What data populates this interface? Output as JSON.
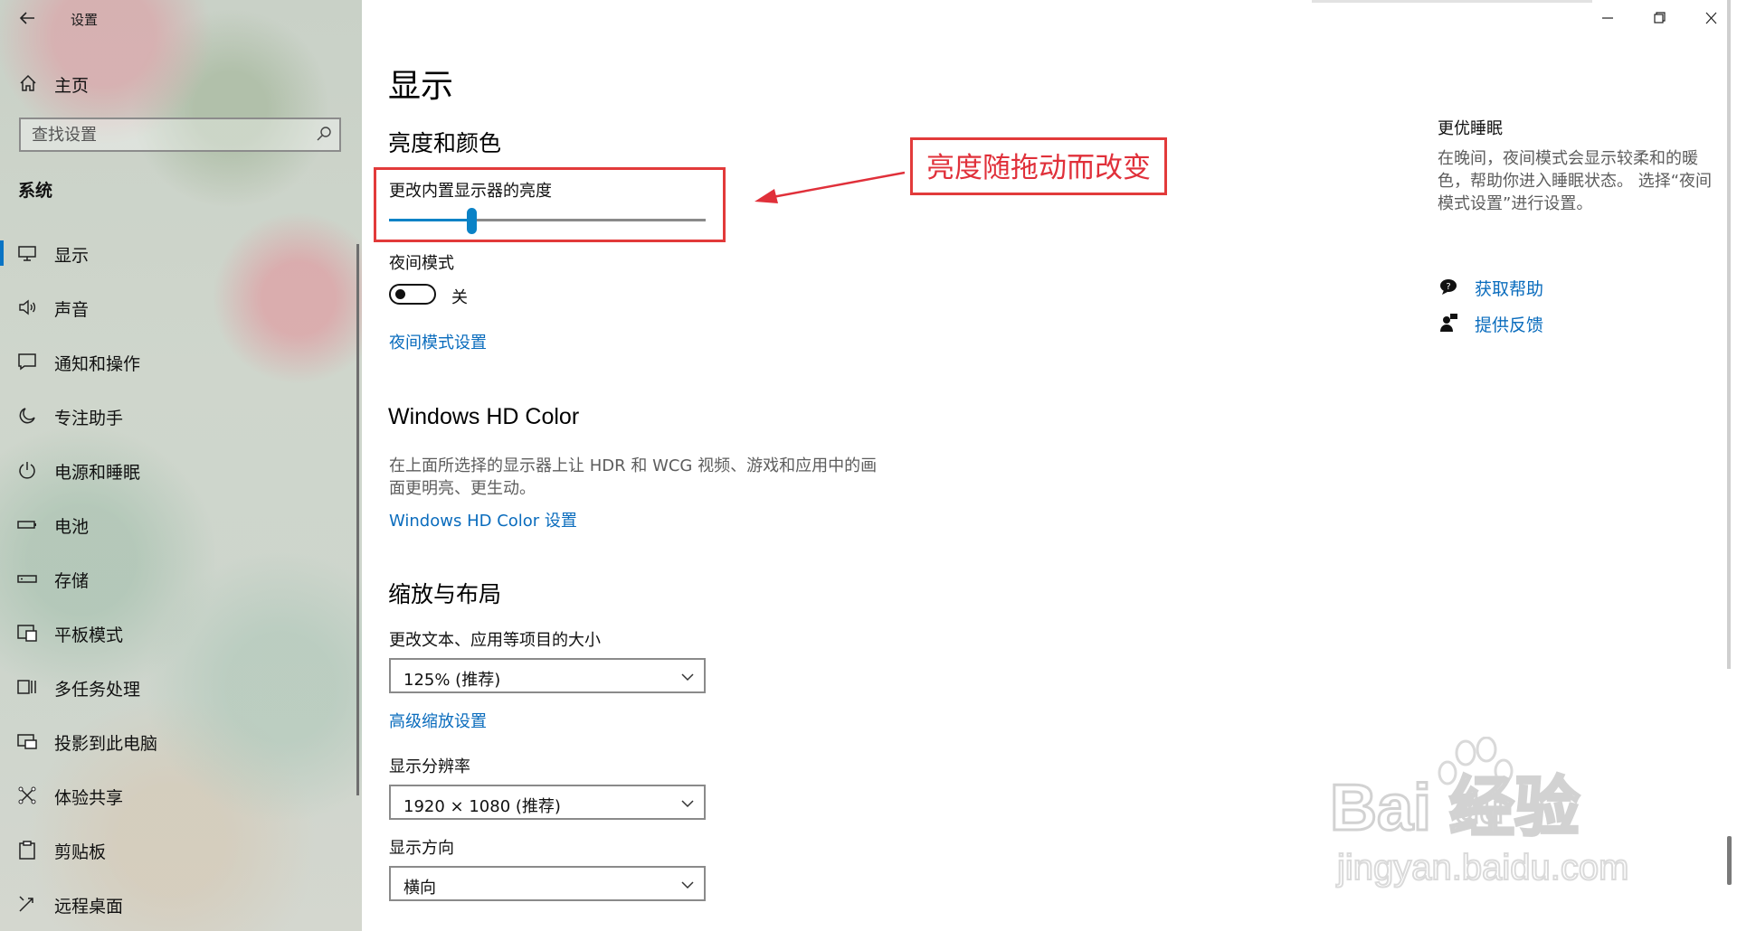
{
  "window": {
    "title": "设置"
  },
  "sidebar": {
    "home_label": "主页",
    "search_placeholder": "查找设置",
    "section_label": "系统",
    "items": [
      {
        "label": "显示",
        "icon": "monitor-icon",
        "active": true
      },
      {
        "label": "声音",
        "icon": "speaker-icon"
      },
      {
        "label": "通知和操作",
        "icon": "notification-icon"
      },
      {
        "label": "专注助手",
        "icon": "moon-icon"
      },
      {
        "label": "电源和睡眠",
        "icon": "power-icon"
      },
      {
        "label": "电池",
        "icon": "battery-icon"
      },
      {
        "label": "存储",
        "icon": "storage-icon"
      },
      {
        "label": "平板模式",
        "icon": "tablet-mode-icon"
      },
      {
        "label": "多任务处理",
        "icon": "multitask-icon"
      },
      {
        "label": "投影到此电脑",
        "icon": "project-icon"
      },
      {
        "label": "体验共享",
        "icon": "share-icon"
      },
      {
        "label": "剪贴板",
        "icon": "clipboard-icon"
      },
      {
        "label": "远程桌面",
        "icon": "remote-desktop-icon"
      }
    ]
  },
  "main": {
    "page_title": "显示",
    "brightness_section": {
      "heading": "亮度和颜色",
      "brightness_label": "更改内置显示器的亮度",
      "brightness_fraction": 0.26,
      "night_mode_label": "夜间模式",
      "night_mode_state": "关",
      "night_mode_settings_link": "夜间模式设置"
    },
    "hdr_section": {
      "heading": "Windows HD Color",
      "description": "在上面所选择的显示器上让 HDR 和 WCG 视频、游戏和应用中的画面更明亮、更生动。",
      "link": "Windows HD Color 设置"
    },
    "scale_section": {
      "heading": "缩放与布局",
      "text_size_label": "更改文本、应用等项目的大小",
      "text_size_value": "125% (推荐)",
      "advanced_link": "高级缩放设置",
      "resolution_label": "显示分辨率",
      "resolution_value": "1920 × 1080 (推荐)",
      "orientation_label": "显示方向",
      "orientation_value": "横向"
    }
  },
  "right_pane": {
    "title": "更优睡眠",
    "description": "在晚间，夜间模式会显示较柔和的暖色，帮助你进入睡眠状态。 选择“夜间模式设置”进行设置。",
    "help_link": "获取帮助",
    "feedback_link": "提供反馈"
  },
  "annotation": {
    "text": "亮度随拖动而改变",
    "color": "#e0303a"
  },
  "watermark": {
    "brand": "Bai 经验",
    "brand_du": "du",
    "url": "jingyan.baidu.com"
  },
  "colors": {
    "accent": "#0a82c6",
    "link": "#0a6cbd"
  }
}
